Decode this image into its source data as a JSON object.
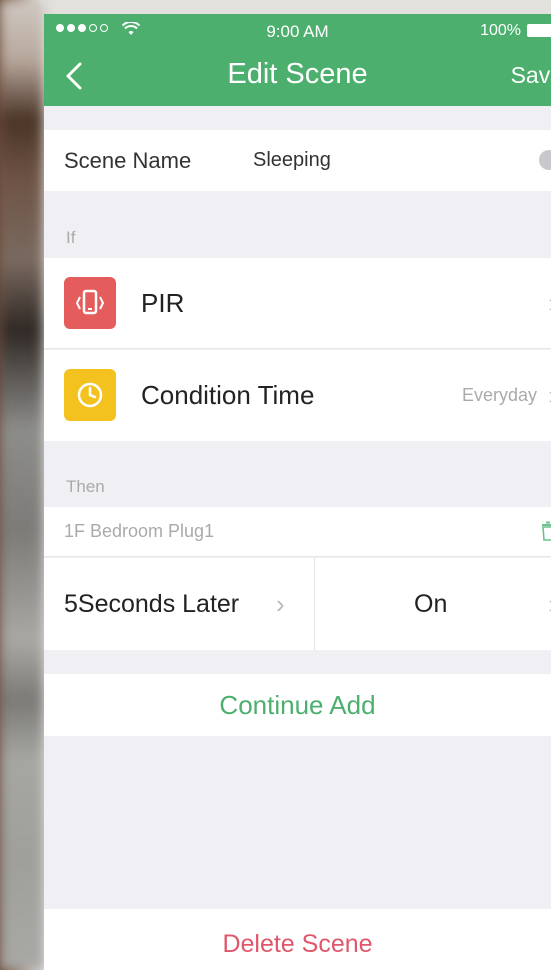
{
  "status_bar": {
    "time": "9:00 AM",
    "battery": "100%"
  },
  "header": {
    "title": "Edit Scene",
    "save_label": "Save",
    "back_icon": "chevron-left-icon",
    "color": "#4caf6e"
  },
  "scene": {
    "label": "Scene Name",
    "value": "Sleeping"
  },
  "if_section": {
    "label": "If",
    "items": [
      {
        "label": "PIR",
        "value": "",
        "icon": "phone-vibrate-icon",
        "color": "#e45c5c"
      },
      {
        "label": "Condition Time",
        "value": "Everyday",
        "icon": "clock-icon",
        "color": "#f4c21f"
      }
    ]
  },
  "then_section": {
    "label": "Then",
    "device": "1F Bedroom Plug1",
    "delay": "5Seconds Later",
    "state": "On"
  },
  "actions": {
    "continue_add": "Continue Add",
    "delete_scene": "Delete Scene",
    "delete_color": "#e0566a"
  }
}
